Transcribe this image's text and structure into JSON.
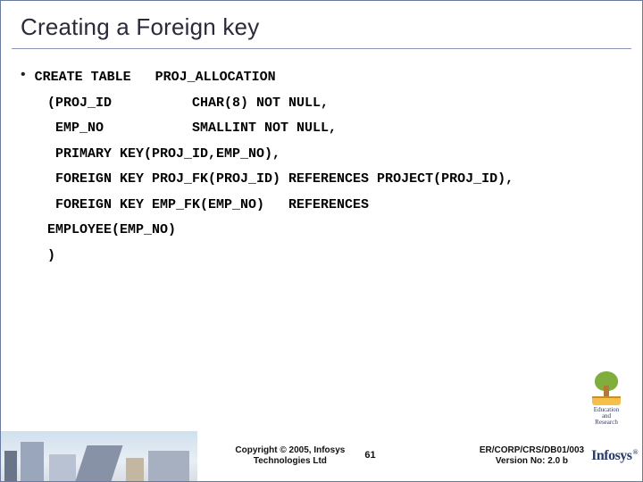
{
  "title": "Creating a Foreign key",
  "bullet": "•",
  "code": {
    "l1": "CREATE TABLE   PROJ_ALLOCATION",
    "l2": "(PROJ_ID          CHAR(8) NOT NULL,",
    "l3": " EMP_NO           SMALLINT NOT NULL,",
    "l4": " PRIMARY KEY(PROJ_ID,EMP_NO),",
    "l5": " FOREIGN KEY PROJ_FK(PROJ_ID) REFERENCES PROJECT(PROJ_ID),",
    "l6": " FOREIGN KEY EMP_FK(EMP_NO)   REFERENCES",
    "l7": "EMPLOYEE(EMP_NO)",
    "l8": ")"
  },
  "footer": {
    "copyright_l1": "Copyright © 2005, Infosys",
    "copyright_l2": "Technologies Ltd",
    "slide_number": "61",
    "docref_l1": "ER/CORP/CRS/DB01/003",
    "docref_l2": "Version No: 2.0 b",
    "logo_text": "Infosys"
  },
  "badge": {
    "line1": "Education",
    "line2": "and",
    "line3": "Research"
  }
}
